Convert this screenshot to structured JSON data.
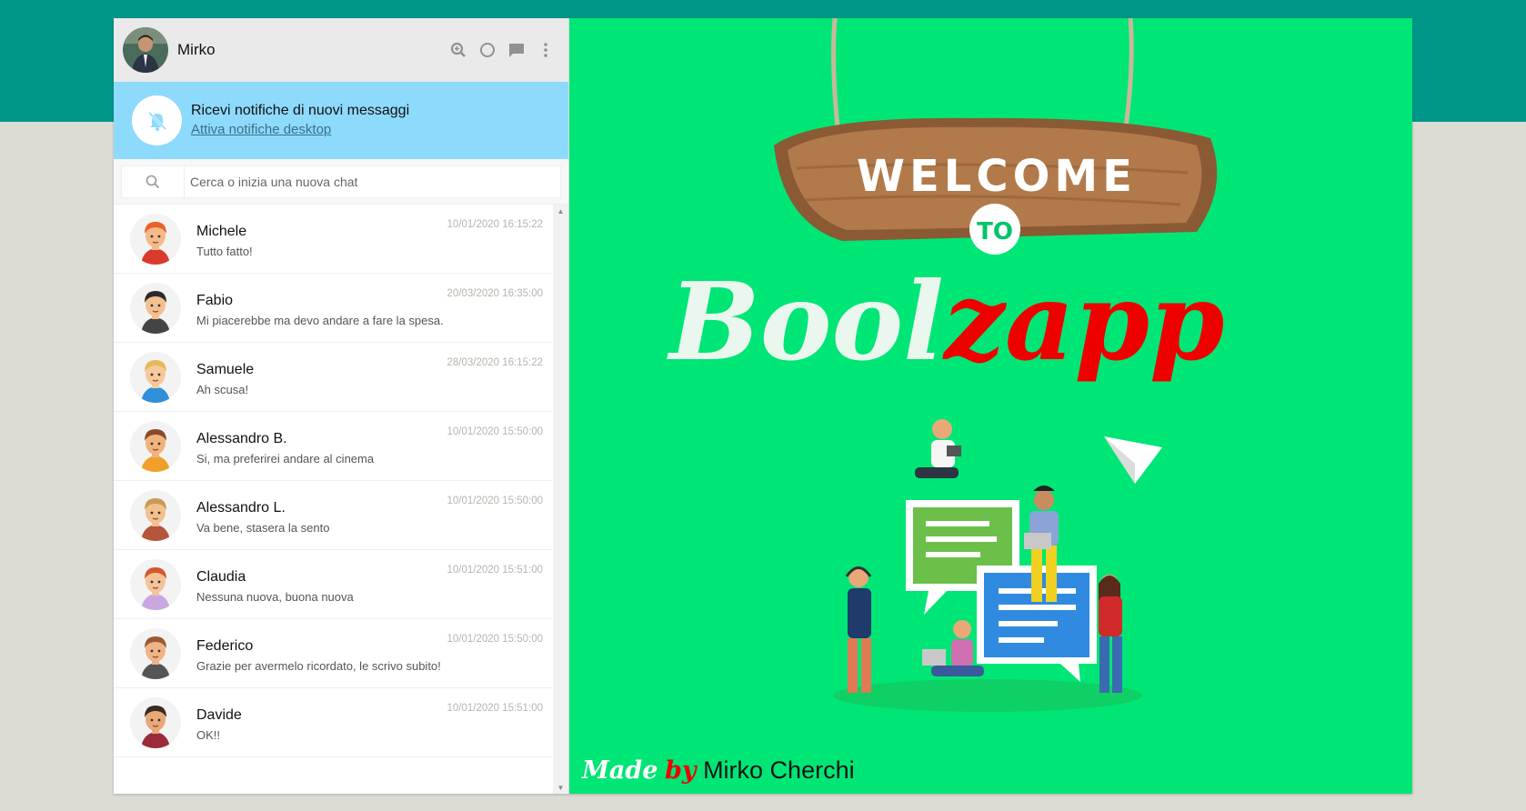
{
  "profile": {
    "name": "Mirko"
  },
  "header_icons": [
    "search-plus-icon",
    "status-circle-icon",
    "chat-icon",
    "more-vert-icon"
  ],
  "notification": {
    "title": "Ricevi notifiche di nuovi messaggi",
    "link": "Attiva notifiche desktop"
  },
  "search": {
    "placeholder": "Cerca o inizia una nuova chat"
  },
  "chats": [
    {
      "name": "Michele",
      "message": "Tutto fatto!",
      "time": "10/01/2020 16:15:22",
      "hair": "#e8622c",
      "skin": "#f6b989",
      "shirt": "#d83a2e"
    },
    {
      "name": "Fabio",
      "message": "Mi piacerebbe ma devo andare a fare la spesa.",
      "time": "20/03/2020 16:35:00",
      "hair": "#2b2b2b",
      "skin": "#f2c091",
      "shirt": "#444444"
    },
    {
      "name": "Samuele",
      "message": "Ah scusa!",
      "time": "28/03/2020 16:15:22",
      "hair": "#e6b95a",
      "skin": "#f6c89a",
      "shirt": "#2f8fd8"
    },
    {
      "name": "Alessandro B.",
      "message": "Si, ma preferirei andare al cinema",
      "time": "10/01/2020 15:50:00",
      "hair": "#8a4a2a",
      "skin": "#f0b37e",
      "shirt": "#f0a02a"
    },
    {
      "name": "Alessandro L.",
      "message": "Va bene, stasera la sento",
      "time": "10/01/2020 15:50:00",
      "hair": "#c99a55",
      "skin": "#f3c08e",
      "shirt": "#b5563a"
    },
    {
      "name": "Claudia",
      "message": "Nessuna nuova, buona nuova",
      "time": "10/01/2020 15:51:00",
      "hair": "#d4572a",
      "skin": "#f6c29a",
      "shirt": "#c9a8e0"
    },
    {
      "name": "Federico",
      "message": "Grazie per avermelo ricordato, le scrivo subito!",
      "time": "10/01/2020 15:50:00",
      "hair": "#9a5a35",
      "skin": "#f0b487",
      "shirt": "#555555"
    },
    {
      "name": "Davide",
      "message": "OK!!",
      "time": "10/01/2020 15:51:00",
      "hair": "#3b2a20",
      "skin": "#e9a978",
      "shirt": "#9b2b3a"
    }
  ],
  "welcome": {
    "sign_line1": "WELCOME",
    "sign_line2": "TO",
    "brand_part1": "Bool",
    "brand_part2": "zapp",
    "credit_made": "Made",
    "credit_by": "by",
    "credit_name": "Mirko Cherchi"
  },
  "colors": {
    "header_band": "#009688",
    "page_bg": "#dcdcd5",
    "notification_bg": "#8edafc",
    "welcome_bg": "#00e676",
    "brand_red": "#ee0000",
    "time_text": "#b9b3ad"
  }
}
